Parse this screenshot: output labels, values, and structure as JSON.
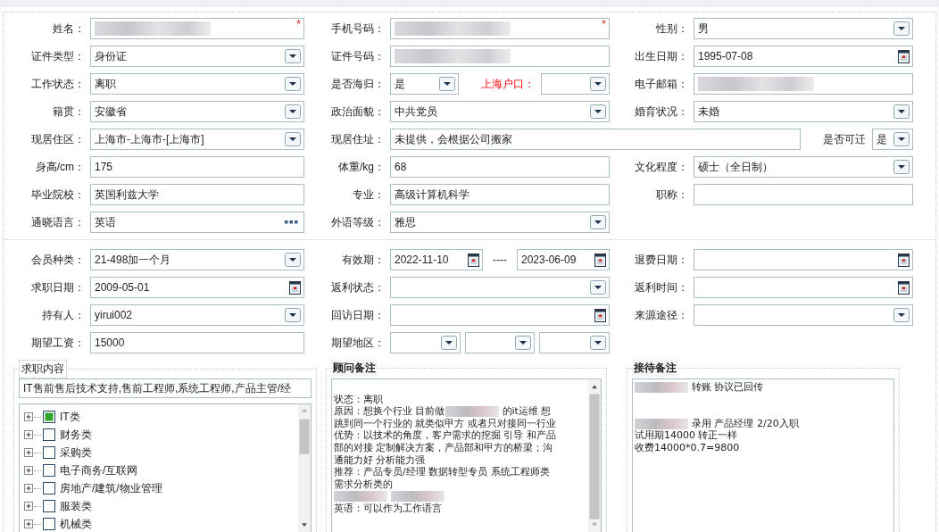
{
  "required_marker": "*",
  "sections": [
    {
      "rows": [
        {
          "groups": [
            {
              "label": "姓名：",
              "controls": [
                {
                  "kind": "text",
                  "blurred": true,
                  "required": true
                }
              ]
            },
            {
              "label": "手机号码：",
              "controls": [
                {
                  "kind": "text",
                  "blurred": true,
                  "required": true
                }
              ]
            },
            {
              "label": "性别：",
              "controls": [
                {
                  "kind": "select",
                  "value": "男",
                  "blurred": false,
                  "required": false
                }
              ]
            }
          ]
        },
        {
          "groups": [
            {
              "label": "证件类型：",
              "controls": [
                {
                  "kind": "select",
                  "value": "身份证",
                  "blurred": false,
                  "required": false
                }
              ]
            },
            {
              "label": "证件号码：",
              "controls": [
                {
                  "kind": "text",
                  "blurred": true,
                  "required": false
                }
              ]
            },
            {
              "label": "出生日期：",
              "controls": [
                {
                  "kind": "date",
                  "value": "1995-07-08",
                  "blurred": false,
                  "required": false
                }
              ]
            }
          ]
        },
        {
          "groups": [
            {
              "label": "工作状态：",
              "controls": [
                {
                  "kind": "select",
                  "value": "离职",
                  "blurred": false,
                  "required": false
                }
              ]
            },
            {
              "label": "是否海归：",
              "controls": [
                {
                  "kind": "select",
                  "value": "是",
                  "blurred": false,
                  "required": false
                },
                {
                  "kind": "label",
                  "text": "上海户口：",
                  "emphasized": true
                },
                {
                  "kind": "select",
                  "blurred": false,
                  "required": false
                }
              ]
            },
            {
              "label": "电子邮箱：",
              "controls": [
                {
                  "kind": "text",
                  "blurred": true,
                  "required": false
                }
              ]
            }
          ]
        },
        {
          "groups": [
            {
              "label": "籍贯：",
              "controls": [
                {
                  "kind": "select",
                  "value": "安徽省",
                  "blurred": false,
                  "required": false
                }
              ]
            },
            {
              "label": "政治面貌：",
              "controls": [
                {
                  "kind": "select",
                  "value": "中共党员",
                  "blurred": false,
                  "required": false
                }
              ]
            },
            {
              "label": "婚育状况：",
              "controls": [
                {
                  "kind": "select",
                  "value": "未婚",
                  "blurred": false,
                  "required": false
                }
              ]
            }
          ]
        },
        {
          "groups": [
            {
              "label": "现居住区：",
              "controls": [
                {
                  "kind": "select",
                  "value": " 上海市-上海市-[上海市]",
                  "blurred": false,
                  "required": false
                }
              ]
            },
            {
              "label": "现居住址：",
              "wide": true,
              "controls": [
                {
                  "kind": "text",
                  "value": "未提供，会根据公司搬家",
                  "blurred": false,
                  "required": false
                },
                {
                  "kind": "label",
                  "text": "是否可迁",
                  "emphasized": false
                },
                {
                  "kind": "select",
                  "value": "是",
                  "blurred": false,
                  "required": false
                }
              ]
            }
          ]
        },
        {
          "groups": [
            {
              "label": "身高/cm：",
              "controls": [
                {
                  "kind": "text",
                  "value": "175",
                  "blurred": false,
                  "required": false
                }
              ]
            },
            {
              "label": "体重/kg：",
              "controls": [
                {
                  "kind": "text",
                  "value": "68",
                  "blurred": false,
                  "required": false
                }
              ]
            },
            {
              "label": "文化程度：",
              "controls": [
                {
                  "kind": "select",
                  "value": "硕士（全日制）",
                  "blurred": false,
                  "required": false
                }
              ]
            }
          ]
        },
        {
          "groups": [
            {
              "label": "毕业院校：",
              "controls": [
                {
                  "kind": "text",
                  "value": "英国利兹大学",
                  "blurred": false,
                  "required": false
                }
              ]
            },
            {
              "label": "专业：",
              "controls": [
                {
                  "kind": "text",
                  "value": "高级计算机科学",
                  "blurred": false,
                  "required": false
                }
              ]
            },
            {
              "label": "职称：",
              "controls": [
                {
                  "kind": "text",
                  "blurred": false,
                  "required": false
                }
              ]
            }
          ]
        },
        {
          "groups": [
            {
              "label": "通晓语言：",
              "controls": [
                {
                  "kind": "picker",
                  "value": "英语",
                  "blurred": false,
                  "required": false
                }
              ]
            },
            {
              "label": "外语等级：",
              "controls": [
                {
                  "kind": "select",
                  "value": "雅思",
                  "blurred": false,
                  "required": false
                }
              ]
            }
          ]
        }
      ]
    },
    {
      "rows": [
        {
          "groups": [
            {
              "label": "会员种类：",
              "controls": [
                {
                  "kind": "select",
                  "value": " 21-498加一个月",
                  "blurred": false,
                  "required": false
                }
              ]
            },
            {
              "label": "有效期：",
              "controls": [
                {
                  "kind": "date",
                  "value": "2022-11-10",
                  "blurred": false,
                  "required": false
                },
                {
                  "kind": "separator",
                  "text": "----"
                },
                {
                  "kind": "date",
                  "value": "2023-06-09",
                  "blurred": false,
                  "required": false
                }
              ]
            },
            {
              "label": "退费日期：",
              "controls": [
                {
                  "kind": "date",
                  "blurred": false,
                  "required": false
                }
              ]
            }
          ]
        },
        {
          "groups": [
            {
              "label": "求职日期：",
              "controls": [
                {
                  "kind": "date",
                  "value": "2009-05-01",
                  "blurred": false,
                  "required": false
                }
              ]
            },
            {
              "label": "返利状态：",
              "controls": [
                {
                  "kind": "select",
                  "blurred": false,
                  "required": false
                }
              ]
            },
            {
              "label": "返利时间：",
              "controls": [
                {
                  "kind": "date",
                  "blurred": false,
                  "required": false
                }
              ]
            }
          ]
        },
        {
          "groups": [
            {
              "label": "持有人：",
              "controls": [
                {
                  "kind": "select",
                  "value": "yirui002",
                  "blurred": false,
                  "required": false
                }
              ]
            },
            {
              "label": "回访日期：",
              "controls": [
                {
                  "kind": "date",
                  "blurred": false,
                  "required": false
                }
              ]
            },
            {
              "label": "来源途径：",
              "controls": [
                {
                  "kind": "select",
                  "blurred": false,
                  "required": false
                }
              ]
            }
          ]
        },
        {
          "groups": [
            {
              "label": "期望工资：",
              "controls": [
                {
                  "kind": "text",
                  "value": "15000",
                  "blurred": false,
                  "required": false
                }
              ]
            },
            {
              "label": "期望地区：",
              "controls": [
                {
                  "kind": "select",
                  "blurred": false,
                  "required": false
                },
                {
                  "kind": "select",
                  "blurred": false,
                  "required": false
                },
                {
                  "kind": "select",
                  "blurred": false,
                  "required": false
                }
              ]
            }
          ]
        }
      ]
    }
  ],
  "panels": [
    {
      "kind": "tree",
      "title": "求职内容",
      "title_bold": false,
      "summary": "IT售前售后技术支持,售前工程师,系统工程师,产品主管/经",
      "items": [
        {
          "label": "IT类",
          "checked": true,
          "expanded": false
        },
        {
          "label": "财务类",
          "checked": false,
          "expanded": false
        },
        {
          "label": "采购类",
          "checked": false,
          "expanded": false
        },
        {
          "label": "电子商务/互联网",
          "checked": false,
          "expanded": false
        },
        {
          "label": "房地产/建筑/物业管理",
          "checked": false,
          "expanded": false
        },
        {
          "label": "服装类",
          "checked": false,
          "expanded": false
        },
        {
          "label": "机械类",
          "checked": false,
          "expanded": false
        }
      ]
    },
    {
      "kind": "notes",
      "title": "顾问备注",
      "title_bold": true,
      "scrollable": true,
      "lines": [
        {
          "kind": "blank"
        },
        {
          "kind": "text",
          "segments": [
            {
              "kind": "text",
              "text": "状态：离职"
            }
          ]
        },
        {
          "kind": "text",
          "segments": [
            {
              "kind": "text",
              "text": "原因：想换个行业 目前做"
            },
            {
              "kind": "blurred"
            },
            {
              "kind": "text",
              "text": "的it运维 想"
            }
          ]
        },
        {
          "kind": "text",
          "segments": [
            {
              "kind": "text",
              "text": "跳到同一个行业的 就类似甲方 或者只对接同一行业"
            }
          ]
        },
        {
          "kind": "text",
          "segments": [
            {
              "kind": "text",
              "text": "优势：以技术的角度，客户需求的挖掘 引导 和产品"
            }
          ]
        },
        {
          "kind": "text",
          "segments": [
            {
              "kind": "text",
              "text": "部的对接  定制解决方案，产品部和甲方的桥梁；沟"
            }
          ]
        },
        {
          "kind": "text",
          "segments": [
            {
              "kind": "text",
              "text": "通能力好  分析能力强"
            }
          ]
        },
        {
          "kind": "text",
          "segments": [
            {
              "kind": "text",
              "text": "推荐：产品专员/经理  数据转型专员 系统工程师类"
            }
          ]
        },
        {
          "kind": "text",
          "segments": [
            {
              "kind": "text",
              "text": "需求分析类的"
            }
          ]
        },
        {
          "kind": "text",
          "segments": [
            {
              "kind": "blurred"
            },
            {
              "kind": "blurred"
            }
          ]
        },
        {
          "kind": "text",
          "segments": [
            {
              "kind": "text",
              "text": "英语：可以作为工作语言"
            }
          ]
        }
      ]
    },
    {
      "kind": "notes",
      "title": "接待备注",
      "title_bold": true,
      "scrollable": false,
      "lines": [
        {
          "kind": "text",
          "segments": [
            {
              "kind": "blurred"
            },
            {
              "kind": "text",
              "text": "转账 协议已回传"
            }
          ]
        },
        {
          "kind": "blank"
        },
        {
          "kind": "blank"
        },
        {
          "kind": "text",
          "segments": [
            {
              "kind": "blurred"
            },
            {
              "kind": "text",
              "text": "录用 产品经理 2/20入职"
            }
          ]
        },
        {
          "kind": "text",
          "segments": [
            {
              "kind": "text",
              "text": "试用期14000 转正一样"
            }
          ]
        },
        {
          "kind": "text",
          "segments": [
            {
              "kind": "text",
              "text": "收费14000*0.7=9800"
            }
          ]
        }
      ]
    }
  ]
}
